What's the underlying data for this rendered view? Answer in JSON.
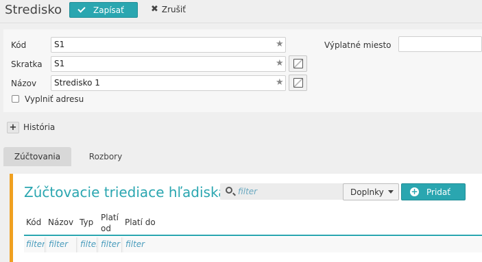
{
  "header": {
    "title": "Stredisko",
    "save_label": "Zapísať",
    "cancel_label": "Zrušiť"
  },
  "form": {
    "kod_label": "Kód",
    "kod_value": "S1",
    "skratka_label": "Skratka",
    "skratka_value": "S1",
    "nazov_label": "Názov",
    "nazov_value": "Stredisko 1",
    "checkbox_label": "Vyplniť adresu",
    "vyplatne_label": "Výplatné miesto",
    "vyplatne_value": ""
  },
  "history": {
    "label": "História"
  },
  "tabs": [
    {
      "label": "Zúčtovania",
      "active": true
    },
    {
      "label": "Rozbory",
      "active": false
    }
  ],
  "section": {
    "title": "Zúčtovacie triediace hľadiská",
    "search_placeholder": "filter",
    "doplnky_label": "Doplnky",
    "add_label": "Pridať"
  },
  "table": {
    "columns": [
      "Kód",
      "Názov",
      "Typ",
      "Platí od",
      "Platí do"
    ],
    "filter_placeholder": "filter"
  },
  "colors": {
    "accent": "#2aa6b0",
    "sidebar_marker": "#f0a020"
  }
}
